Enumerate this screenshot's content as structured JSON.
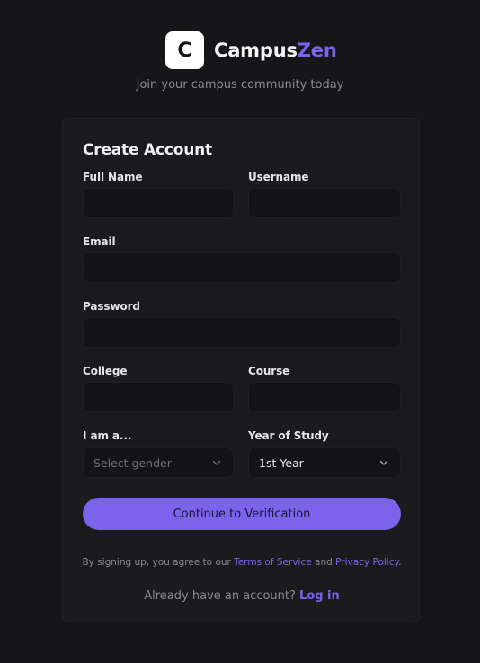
{
  "brand": {
    "logo_letter": "C",
    "name_main": "Campus",
    "name_accent": "Zen"
  },
  "tagline": "Join your campus community today",
  "form": {
    "title": "Create Account",
    "full_name": {
      "label": "Full Name",
      "value": "",
      "placeholder": ""
    },
    "username": {
      "label": "Username",
      "value": "",
      "placeholder": ""
    },
    "email": {
      "label": "Email",
      "value": "",
      "placeholder": ""
    },
    "password": {
      "label": "Password",
      "value": "",
      "placeholder": ""
    },
    "college": {
      "label": "College",
      "value": "",
      "placeholder": ""
    },
    "course": {
      "label": "Course",
      "value": "",
      "placeholder": ""
    },
    "gender": {
      "label": "I am a...",
      "selected": "Select gender"
    },
    "year": {
      "label": "Year of Study",
      "selected": "1st Year"
    },
    "submit_label": "Continue to Verification"
  },
  "terms": {
    "prefix": "By signing up, you agree to our ",
    "tos": "Terms of Service",
    "and": " and ",
    "privacy": "Privacy Policy",
    "suffix": "."
  },
  "login": {
    "prompt": "Already have an account? ",
    "link": "Log in"
  },
  "colors": {
    "accent": "#7b63ec",
    "background": "#161618",
    "card": "#1b1b1e",
    "input": "#141416"
  }
}
